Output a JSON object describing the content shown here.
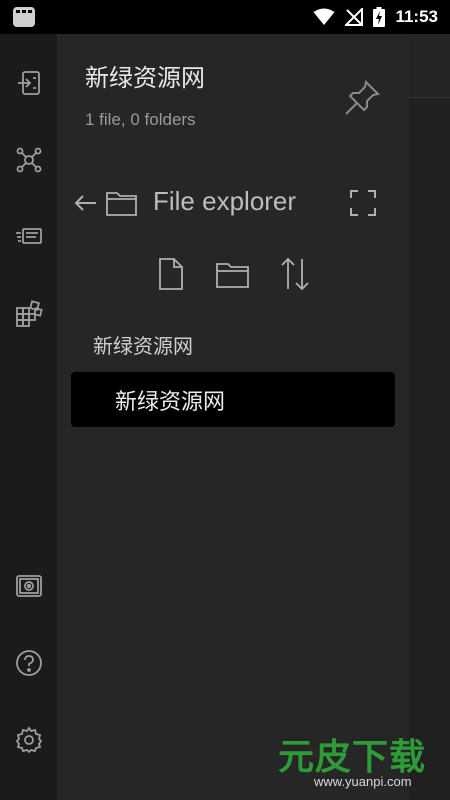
{
  "status_bar": {
    "time": "11:53"
  },
  "drawer": {
    "vault_name": "新绿资源网",
    "vault_stats": "1 file, 0 folders",
    "explorer_title": "File explorer",
    "root_folder": "新绿资源网",
    "files": [
      {
        "name": "新绿资源网",
        "selected": true
      }
    ]
  },
  "ribbon": {
    "top_icons": [
      "open-note-icon",
      "graph-view-icon",
      "slides-icon",
      "plugins-grid-icon"
    ],
    "bottom_icons": [
      "vault-icon",
      "help-icon",
      "settings-icon"
    ]
  },
  "watermark": {
    "brand": "元皮下载",
    "url": "www.yuanpi.com"
  },
  "colors": {
    "drawer_bg": "#262626",
    "ribbon_bg": "#1b1b1b",
    "selected_bg": "#000000",
    "watermark_green": "#2e9b39"
  }
}
